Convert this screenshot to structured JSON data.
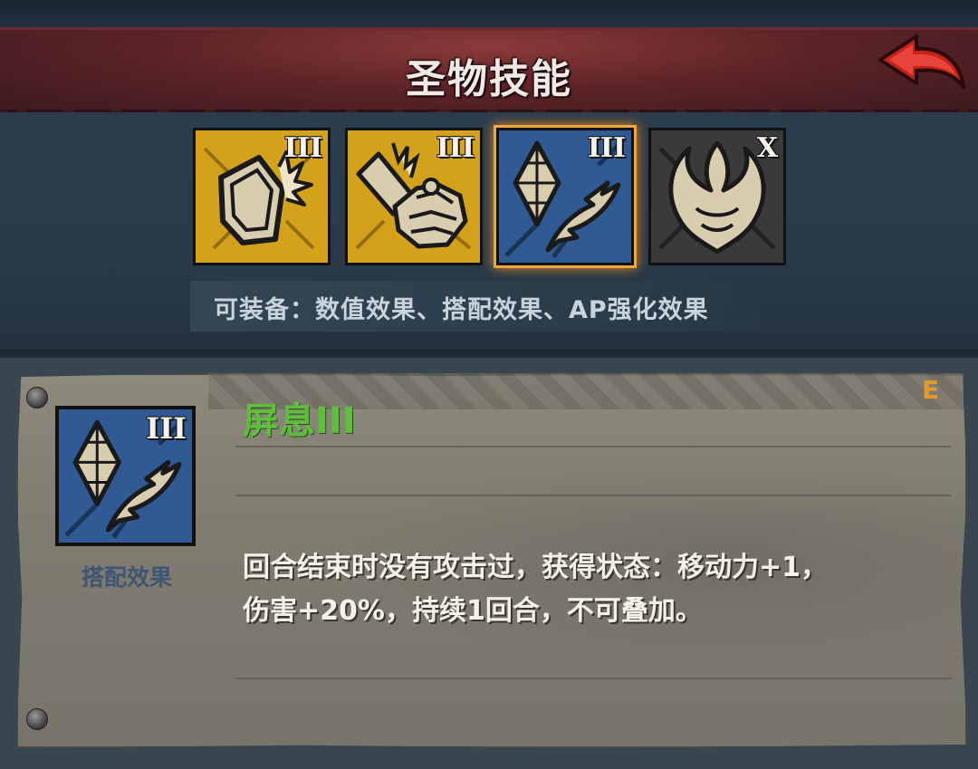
{
  "header": {
    "title": "圣物技能",
    "back_icon": "red-back-arrow-icon"
  },
  "skills": [
    {
      "icon": "broken-shield-icon",
      "rank": "III",
      "bg_color": "#d3a21a"
    },
    {
      "icon": "armored-gauntlet-icon",
      "rank": "III",
      "bg_color": "#d3a21a"
    },
    {
      "icon": "crystal-feather-icon",
      "rank": "III",
      "bg_color": "#2f5a93",
      "selected": true
    },
    {
      "icon": "horned-helm-icon",
      "rank": "X",
      "bg_color": "#3a3a3a"
    }
  ],
  "equip_info": "可装备：数值效果、搭配效果、AP强化效果",
  "detail": {
    "icon": "crystal-feather-icon",
    "rank": "III",
    "type_label": "搭配效果",
    "name": "屏息III",
    "grade": "E",
    "description_line1": "回合结束时没有攻击过，获得状态：移动力+1，",
    "description_line2": "伤害+20%，持续1回合，不可叠加。"
  },
  "colors": {
    "header_red": "#5e2427",
    "selected_border": "#f2a53a",
    "name_green": "#5fbe3c",
    "grade_orange": "#e39a2b"
  }
}
